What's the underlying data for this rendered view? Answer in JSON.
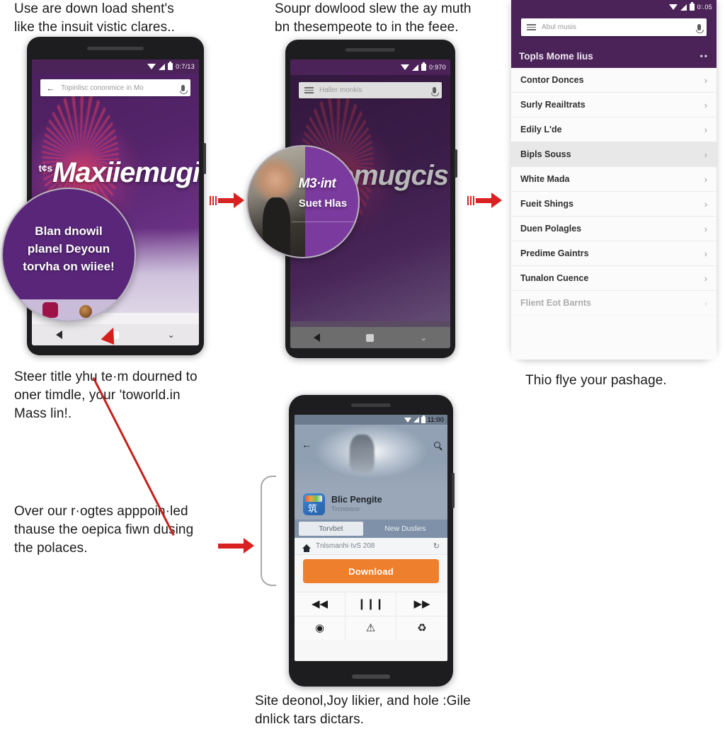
{
  "captions": {
    "top_left": "Use are down load shent's\nlike the insuit vistic clares..",
    "top_mid": "Soupr dowlood slew the ay muth\nbn thesempeote to in the feee.",
    "mid_left": "Steer title yhu te·m dourned to\noner timdle, your 'toworld.in\nMass lin!.",
    "low_left": "Over our r·ogtes apppoin·led\nthause the oepica fiwn dusing\nthe polaces.",
    "right": "Thio flye your pashage.",
    "bottom": "Site deonol,Joy likier, and hole :Gile\ndnlick tars dictars."
  },
  "phone1": {
    "status": {
      "clock": "0:7/13",
      "wifi": "wifi-icon",
      "signal": "signal-icon",
      "battery": "battery-icon"
    },
    "search": {
      "back": "←",
      "text": "Topinlisc cononmice in Mo",
      "mic": "mic-icon"
    },
    "hero_title": "Maxiiemugicis",
    "hero_sup": "tG",
    "hero_sup2": "t¢s",
    "nav": {
      "back": "back-triangle",
      "home": "home-square",
      "recents": "⌄"
    },
    "callout": "Blan dnowil\nplanel Deyoun\ntorvha on wiiee!"
  },
  "phone2": {
    "status": {
      "clock": "0:970"
    },
    "search": {
      "text": "Haller monkis",
      "mic": "mic-icon"
    },
    "hero_title": "emugcis",
    "callout": {
      "title": "M3·int",
      "subtitle": "Suet Hlas"
    },
    "nav": {
      "recents": "⌄"
    }
  },
  "phone3": {
    "status": {
      "clock": "0∶.05"
    },
    "search": {
      "text": "Abul musis",
      "mic": "mic-icon"
    },
    "header": {
      "title": "Topls Mome lius",
      "menu": "••"
    },
    "rows": [
      {
        "label": "Contor Donces",
        "alt": false
      },
      {
        "label": "Surly Reailtrats",
        "alt": false
      },
      {
        "label": "Edily L'de",
        "alt": false
      },
      {
        "label": "Bipls Souss",
        "alt": true
      },
      {
        "label": "White Mada",
        "alt": false
      },
      {
        "label": "Fueit Shings",
        "alt": false
      },
      {
        "label": "Duen Polagles",
        "alt": false
      },
      {
        "label": "Predime Gaintrs",
        "alt": false
      },
      {
        "label": "Tunalon Cuence",
        "alt": false
      },
      {
        "label": "Flient Eot Barnts",
        "alt": false
      }
    ],
    "chevron": "›"
  },
  "phone4": {
    "status": {
      "clock": "11:00"
    },
    "top": {
      "back": "←",
      "search": "search-icon"
    },
    "app": {
      "name": "Blic Pengite",
      "sub": "Trcnoıoıo"
    },
    "tabs": [
      {
        "label": "Torvbet",
        "active": true
      },
      {
        "label": "New Duslies",
        "active": false
      }
    ],
    "path": {
      "home": "home-icon",
      "text": "Tnlsmanhi·tvS 208",
      "refresh": "↻"
    },
    "download_label": "Download",
    "controls": [
      {
        "icon": "◀◀",
        "name": "rewind-icon"
      },
      {
        "icon": "❙❙❙",
        "name": "pause-icon"
      },
      {
        "icon": "▶▶",
        "name": "fast-forward-icon"
      },
      {
        "icon": "◉",
        "name": "record-icon"
      },
      {
        "icon": "⚠",
        "name": "warning-icon"
      },
      {
        "icon": "♻",
        "name": "loop-icon"
      }
    ]
  },
  "colors": {
    "accent_purple": "#4b2359",
    "download_orange": "#ee7f2d",
    "arrow_red": "#d92121",
    "background": "#ffffff"
  }
}
